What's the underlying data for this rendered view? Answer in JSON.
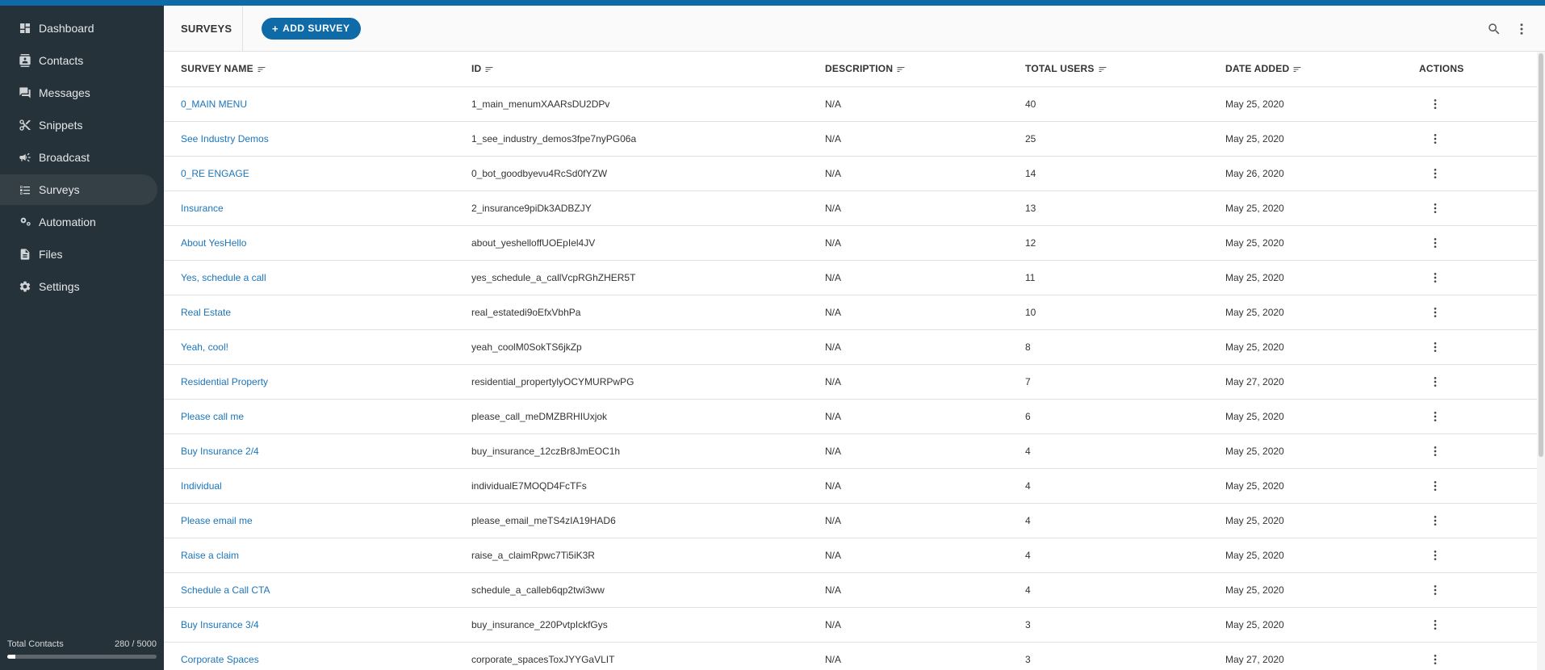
{
  "colors": {
    "brand": "#0f6aa8",
    "sidebar_bg": "#263239",
    "link": "#1b75bb"
  },
  "sidebar": {
    "items": [
      {
        "label": "Dashboard",
        "icon": "dashboard-icon"
      },
      {
        "label": "Contacts",
        "icon": "contacts-icon"
      },
      {
        "label": "Messages",
        "icon": "messages-icon"
      },
      {
        "label": "Snippets",
        "icon": "scissors-icon"
      },
      {
        "label": "Broadcast",
        "icon": "megaphone-icon"
      },
      {
        "label": "Surveys",
        "icon": "survey-list-icon",
        "active": true
      },
      {
        "label": "Automation",
        "icon": "automation-icon"
      },
      {
        "label": "Files",
        "icon": "file-icon"
      },
      {
        "label": "Settings",
        "icon": "gear-icon"
      }
    ],
    "footer": {
      "label": "Total Contacts",
      "value": "280 / 5000",
      "progress_fraction": 0.056
    }
  },
  "toolbar": {
    "title": "SURVEYS",
    "add_plus": "+",
    "add_label": "ADD SURVEY",
    "search_icon": "search-icon",
    "more_icon": "more-vertical-icon"
  },
  "table": {
    "headers": {
      "name": "SURVEY NAME",
      "id": "ID",
      "description": "DESCRIPTION",
      "total_users": "TOTAL USERS",
      "date_added": "DATE ADDED",
      "actions": "ACTIONS"
    },
    "rows": [
      {
        "name": "0_MAIN MENU",
        "id": "1_main_menumXAARsDU2DPv",
        "description": "N/A",
        "total_users": "40",
        "date_added": "May 25, 2020"
      },
      {
        "name": "See Industry Demos",
        "id": "1_see_industry_demos3fpe7nyPG06a",
        "description": "N/A",
        "total_users": "25",
        "date_added": "May 25, 2020"
      },
      {
        "name": "0_RE ENGAGE",
        "id": "0_bot_goodbyevu4RcSd0fYZW",
        "description": "N/A",
        "total_users": "14",
        "date_added": "May 26, 2020"
      },
      {
        "name": "Insurance",
        "id": "2_insurance9piDk3ADBZJY",
        "description": "N/A",
        "total_users": "13",
        "date_added": "May 25, 2020"
      },
      {
        "name": "About YesHello",
        "id": "about_yeshelloffUOEpIel4JV",
        "description": "N/A",
        "total_users": "12",
        "date_added": "May 25, 2020"
      },
      {
        "name": "Yes, schedule a call",
        "id": "yes_schedule_a_callVcpRGhZHER5T",
        "description": "N/A",
        "total_users": "11",
        "date_added": "May 25, 2020"
      },
      {
        "name": "Real Estate",
        "id": "real_estatedi9oEfxVbhPa",
        "description": "N/A",
        "total_users": "10",
        "date_added": "May 25, 2020"
      },
      {
        "name": "Yeah, cool!",
        "id": "yeah_coolM0SokTS6jkZp",
        "description": "N/A",
        "total_users": "8",
        "date_added": "May 25, 2020"
      },
      {
        "name": "Residential Property",
        "id": "residential_propertylyOCYMURPwPG",
        "description": "N/A",
        "total_users": "7",
        "date_added": "May 27, 2020"
      },
      {
        "name": "Please call me",
        "id": "please_call_meDMZBRHIUxjok",
        "description": "N/A",
        "total_users": "6",
        "date_added": "May 25, 2020"
      },
      {
        "name": "Buy Insurance 2/4",
        "id": "buy_insurance_12czBr8JmEOC1h",
        "description": "N/A",
        "total_users": "4",
        "date_added": "May 25, 2020"
      },
      {
        "name": "Individual",
        "id": "individualE7MOQD4FcTFs",
        "description": "N/A",
        "total_users": "4",
        "date_added": "May 25, 2020"
      },
      {
        "name": "Please email me",
        "id": "please_email_meTS4zIA19HAD6",
        "description": "N/A",
        "total_users": "4",
        "date_added": "May 25, 2020"
      },
      {
        "name": "Raise a claim",
        "id": "raise_a_claimRpwc7Ti5iK3R",
        "description": "N/A",
        "total_users": "4",
        "date_added": "May 25, 2020"
      },
      {
        "name": "Schedule a Call CTA",
        "id": "schedule_a_calleb6qp2twi3ww",
        "description": "N/A",
        "total_users": "4",
        "date_added": "May 25, 2020"
      },
      {
        "name": "Buy Insurance 3/4",
        "id": "buy_insurance_220PvtpIckfGys",
        "description": "N/A",
        "total_users": "3",
        "date_added": "May 25, 2020"
      },
      {
        "name": "Corporate Spaces",
        "id": "corporate_spacesToxJYYGaVLIT",
        "description": "N/A",
        "total_users": "3",
        "date_added": "May 27, 2020"
      }
    ]
  }
}
